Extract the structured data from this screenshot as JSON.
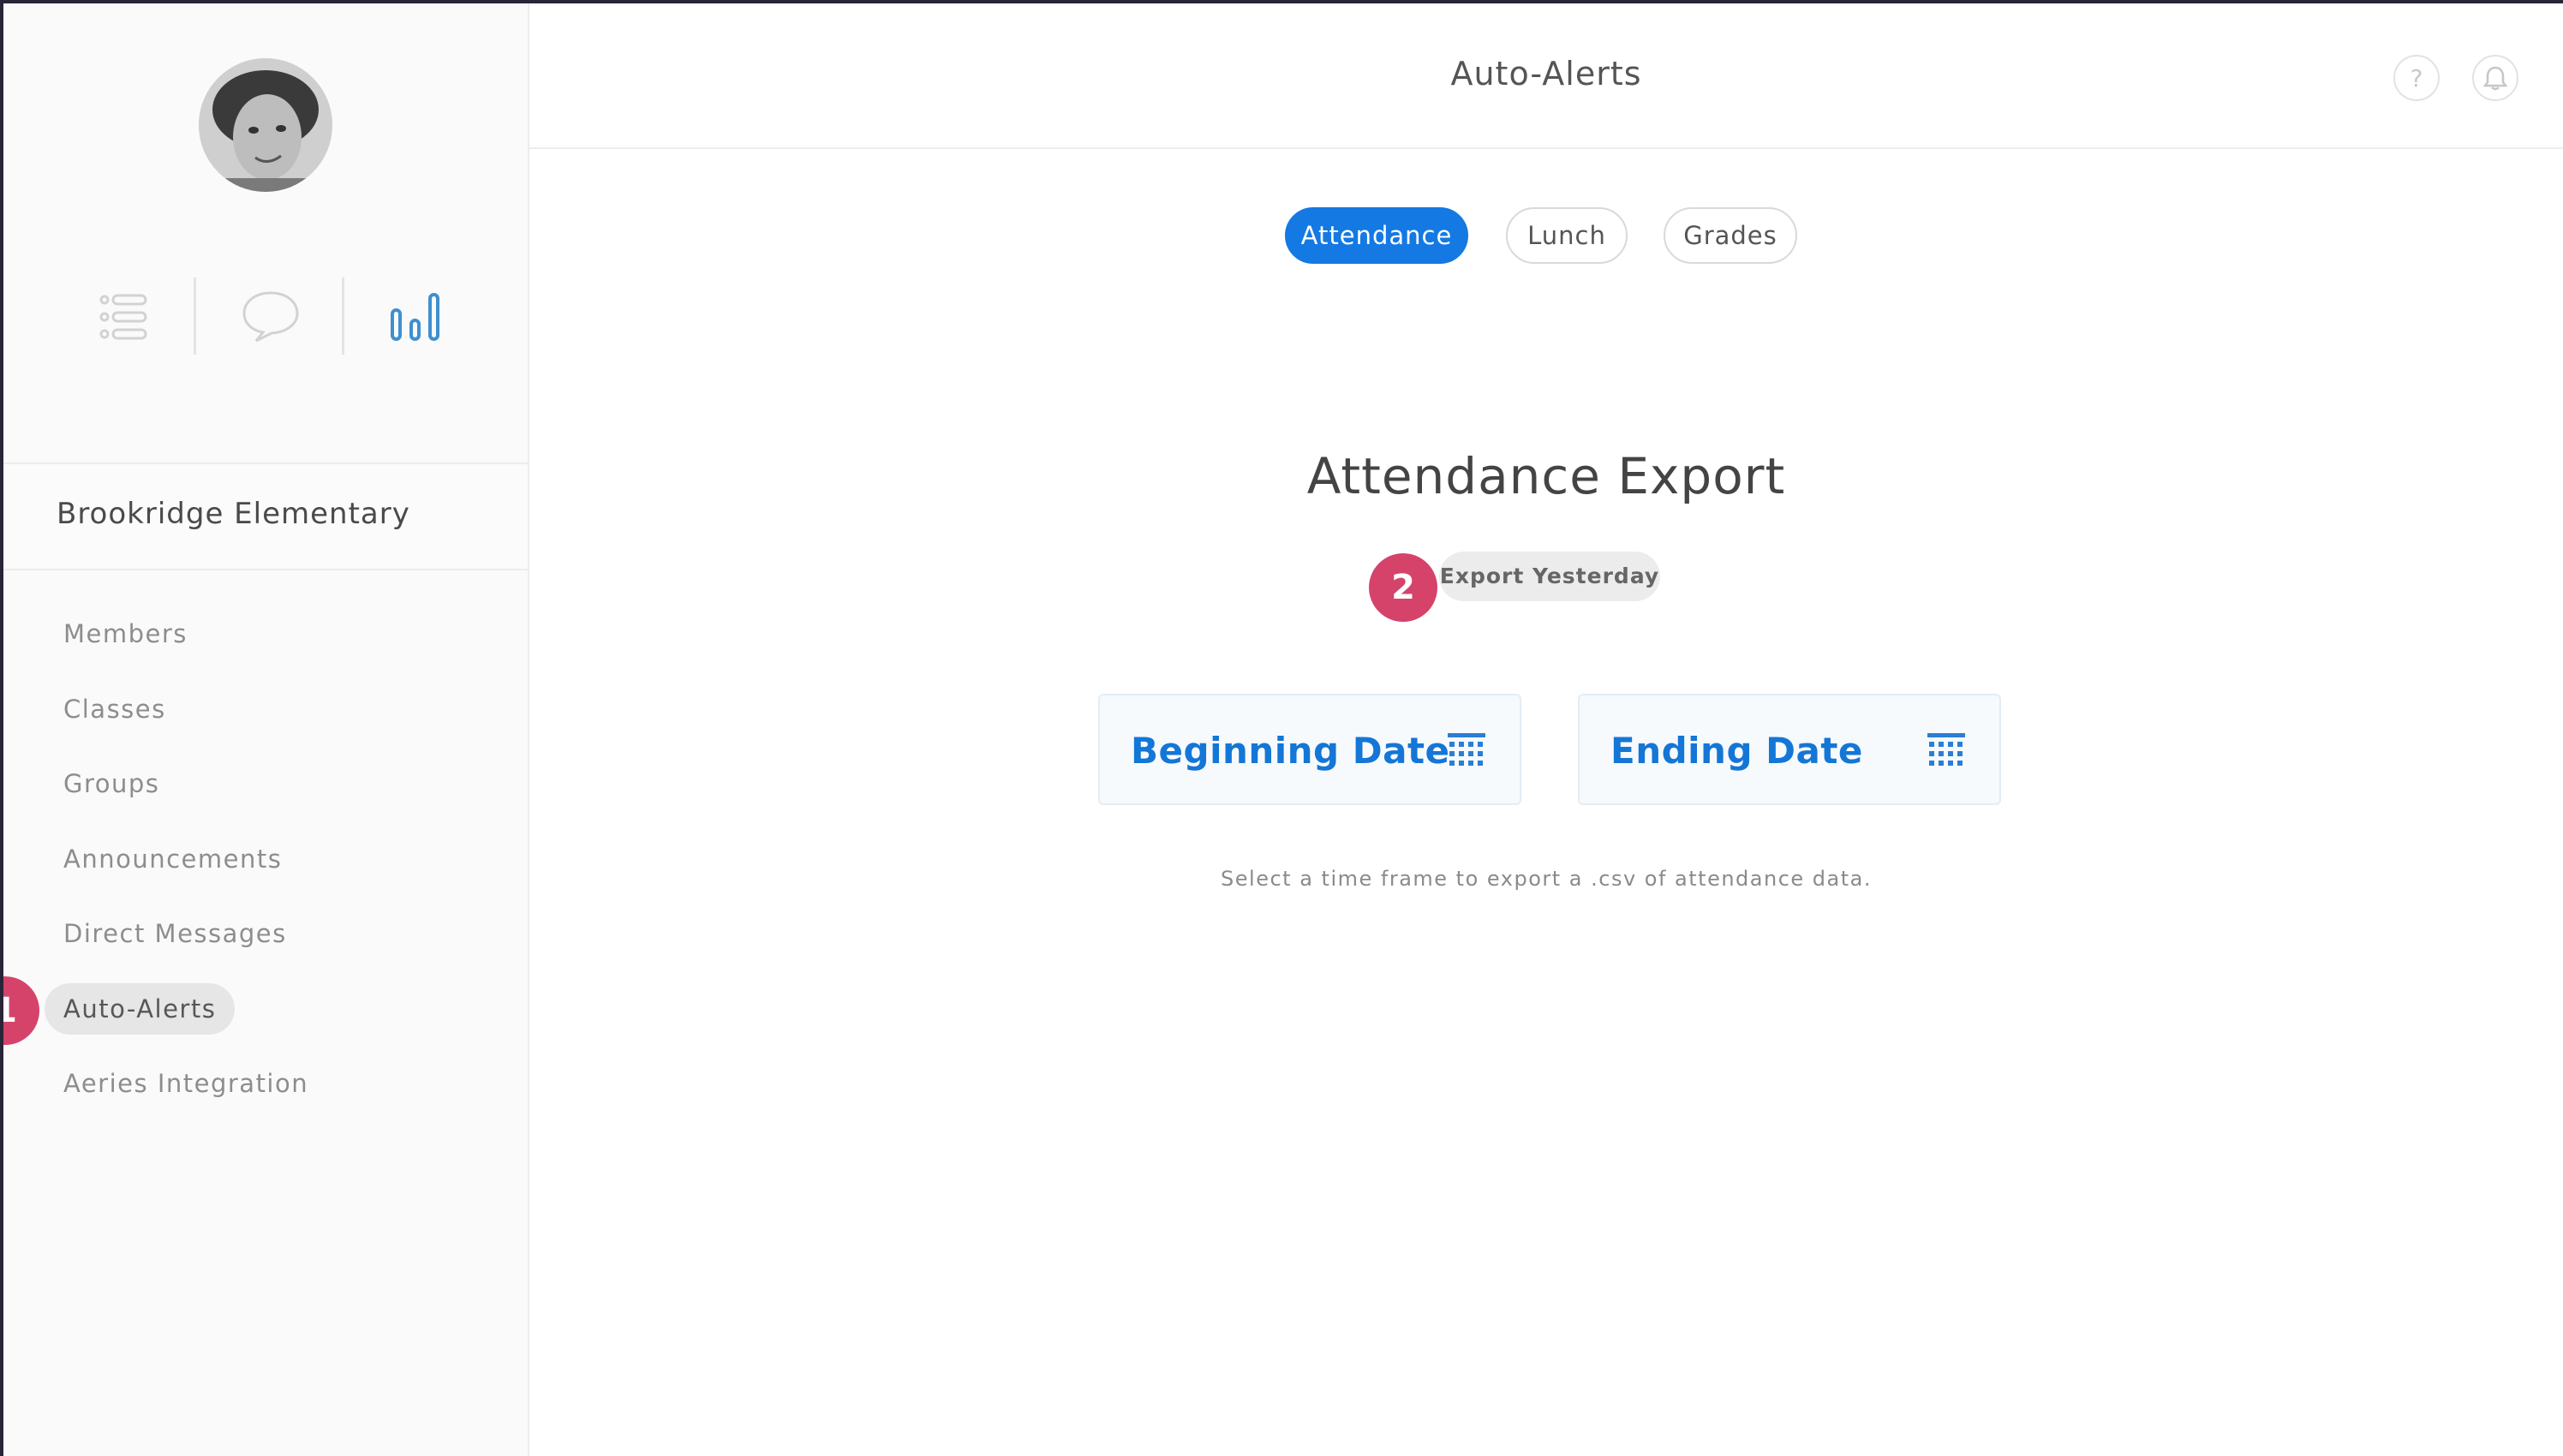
{
  "header": {
    "title": "Auto-Alerts",
    "help_icon": "question-icon",
    "bell_icon": "bell-icon"
  },
  "sidebar": {
    "avatar": "user-avatar",
    "view_icons": [
      "list-icon",
      "chat-icon",
      "bar-chart-icon"
    ],
    "school_name": "Brookridge Elementary",
    "items": [
      {
        "label": "Members"
      },
      {
        "label": "Classes"
      },
      {
        "label": "Groups"
      },
      {
        "label": "Announcements"
      },
      {
        "label": "Direct Messages"
      },
      {
        "label": "Auto-Alerts",
        "active": true
      },
      {
        "label": "Aeries Integration"
      }
    ]
  },
  "tabs": [
    {
      "label": "Attendance",
      "active": true
    },
    {
      "label": "Lunch"
    },
    {
      "label": "Grades"
    }
  ],
  "main": {
    "title": "Attendance Export",
    "export_button": "Export Yesterday",
    "beginning_date": "Beginning Date",
    "ending_date": "Ending Date",
    "hint": "Select a time frame to export a .csv of attendance data."
  },
  "annotations": [
    "1",
    "2"
  ],
  "colors": {
    "accent": "#1479e3",
    "step_marker": "#d5436a",
    "date_text": "#1476d6"
  }
}
